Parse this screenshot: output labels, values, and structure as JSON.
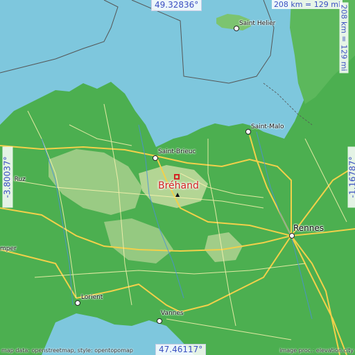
{
  "map": {
    "coords": {
      "top": "49.32836°",
      "bottom": "47.46117°",
      "left": "-3.80037°",
      "right": "-1.16787°"
    },
    "scale": {
      "horizontal": "208 km = 129 mi",
      "vertical": "208 km = 129 mi"
    },
    "focus_place": "Bréhand",
    "cities": [
      {
        "name": "Saint Helier"
      },
      {
        "name": "Saint-Malo"
      },
      {
        "name": "Saint-Brieuc"
      },
      {
        "name": "Rennes"
      },
      {
        "name": "Lorient"
      },
      {
        "name": "Vannes"
      },
      {
        "name": "mper"
      },
      {
        "name": "h Ruz"
      }
    ],
    "attribution": {
      "left": "map data: openstreetmap, style: opentopomap",
      "right": "image proc.: elevation.city"
    },
    "colors": {
      "sea": "#7ec7dd",
      "land_low": "#4caf50",
      "land_mid": "#8bc57a",
      "land_high": "#c8d99a",
      "road_major": "#f2d04a",
      "road_minor": "#ffffff",
      "accent": "#3a4fc2",
      "focus": "#d22323"
    }
  }
}
